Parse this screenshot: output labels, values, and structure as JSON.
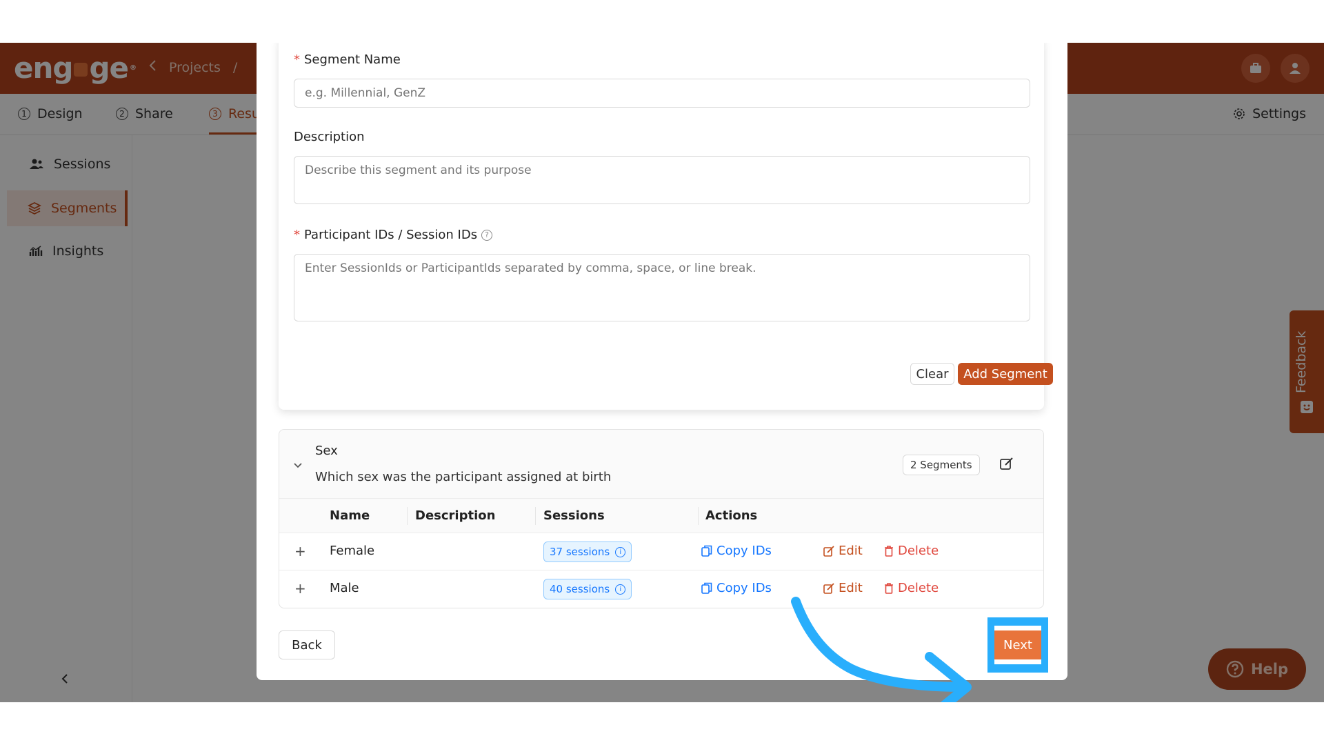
{
  "app": {
    "breadcrumb": {
      "projects": "Projects",
      "separator": "/"
    },
    "tabs": [
      {
        "num": "1",
        "label": "Design"
      },
      {
        "num": "2",
        "label": "Share"
      },
      {
        "num": "3",
        "label": "Resu"
      }
    ],
    "settings_label": "Settings",
    "sidebar": {
      "items": [
        {
          "label": "Sessions",
          "icon": "users-icon"
        },
        {
          "label": "Segments",
          "icon": "layers-icon"
        },
        {
          "label": "Insights",
          "icon": "chart-icon"
        }
      ],
      "collapse": "<"
    },
    "feedback_label": "Feedback",
    "help_label": "Help",
    "brand_color": "#c4501f"
  },
  "modal": {
    "form": {
      "name_label": "Segment Name",
      "name_placeholder": "e.g. Millennial, GenZ",
      "desc_label": "Description",
      "desc_placeholder": "Describe this segment and its purpose",
      "ids_label": "Participant IDs / Session IDs",
      "ids_placeholder": "Enter SessionIds or ParticipantIds separated by comma, space, or line break.",
      "required_mark": "*",
      "clear_label": "Clear",
      "add_label": "Add Segment"
    },
    "group": {
      "title": "Sex",
      "description": "Which sex was the participant assigned at birth",
      "count_label": "2 Segments",
      "columns": [
        "Name",
        "Description",
        "Sessions",
        "Actions"
      ],
      "rows": [
        {
          "name": "Female",
          "description": "",
          "sessions": "37 sessions"
        },
        {
          "name": "Male",
          "description": "",
          "sessions": "40 sessions"
        }
      ],
      "actions": {
        "copy": "Copy IDs",
        "edit": "Edit",
        "delete": "Delete"
      }
    },
    "back_label": "Back",
    "next_label": "Next"
  }
}
